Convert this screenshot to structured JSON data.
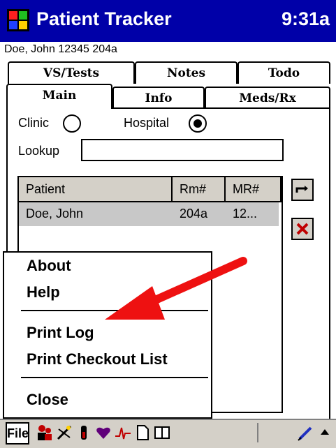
{
  "window": {
    "title": "Patient Tracker",
    "clock": "9:31a"
  },
  "patient_line": "Doe, John 12345 204a",
  "tabs_back": [
    "VS/Tests",
    "Notes",
    "Todo"
  ],
  "tabs_front": [
    "Main",
    "Info",
    "Meds/Rx"
  ],
  "location": {
    "clinic_label": "Clinic",
    "hospital_label": "Hospital",
    "selected": "Hospital"
  },
  "lookup": {
    "label": "Lookup",
    "value": ""
  },
  "table": {
    "columns": [
      "Patient",
      "Rm#",
      "MR#"
    ],
    "rows": [
      {
        "patient": "Doe, John",
        "rm": "204a",
        "mr": "12..."
      }
    ]
  },
  "menu": {
    "items": [
      "About",
      "Help",
      "Print Log",
      "Print Checkout List",
      "Close"
    ]
  },
  "toolbar": {
    "file_label": "File"
  },
  "icons": [
    "app-flag-icon",
    "refresh-icon",
    "delete-icon",
    "patients-icon",
    "procedure-icon",
    "test-tube-icon",
    "heart-icon",
    "ekg-icon",
    "document-icon",
    "book-icon",
    "pen-icon",
    "up-arrow-icon"
  ],
  "colors": {
    "titlebar": "#0000a8",
    "arrow": "#ee1111",
    "selected_row": "#c8c8c8"
  }
}
